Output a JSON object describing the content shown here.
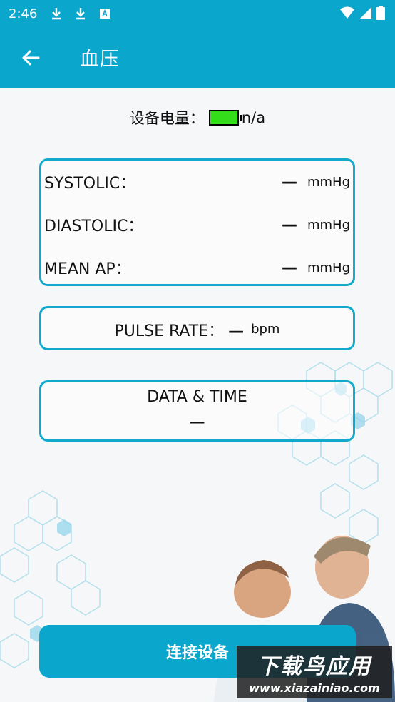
{
  "status_bar": {
    "time": "2:46",
    "icons": [
      "download-icon",
      "download-icon",
      "font-icon"
    ],
    "right_icons": [
      "wifi-icon",
      "cell-signal-icon",
      "battery-icon"
    ]
  },
  "app_bar": {
    "title": "血压"
  },
  "battery": {
    "label": "设备电量：",
    "value": "n/a",
    "color": "#33dd1a"
  },
  "measurements": {
    "systolic": {
      "label": "SYSTOLIC：",
      "value": "—",
      "unit": "mmHg"
    },
    "diastolic": {
      "label": "DIASTOLIC：",
      "value": "—",
      "unit": "mmHg"
    },
    "mean_ap": {
      "label": "MEAN AP：",
      "value": "—",
      "unit": "mmHg"
    }
  },
  "pulse": {
    "label": "PULSE RATE：",
    "value": "—",
    "unit": "bpm"
  },
  "datetime": {
    "label": "DATA & TIME",
    "value": "—"
  },
  "connect_button": {
    "label": "连接设备"
  },
  "watermark": {
    "line1": "下载鸟应用",
    "line2": "www.xiazainiao.com"
  },
  "colors": {
    "accent": "#0aa6cc",
    "card_border": "#12a9cc"
  }
}
